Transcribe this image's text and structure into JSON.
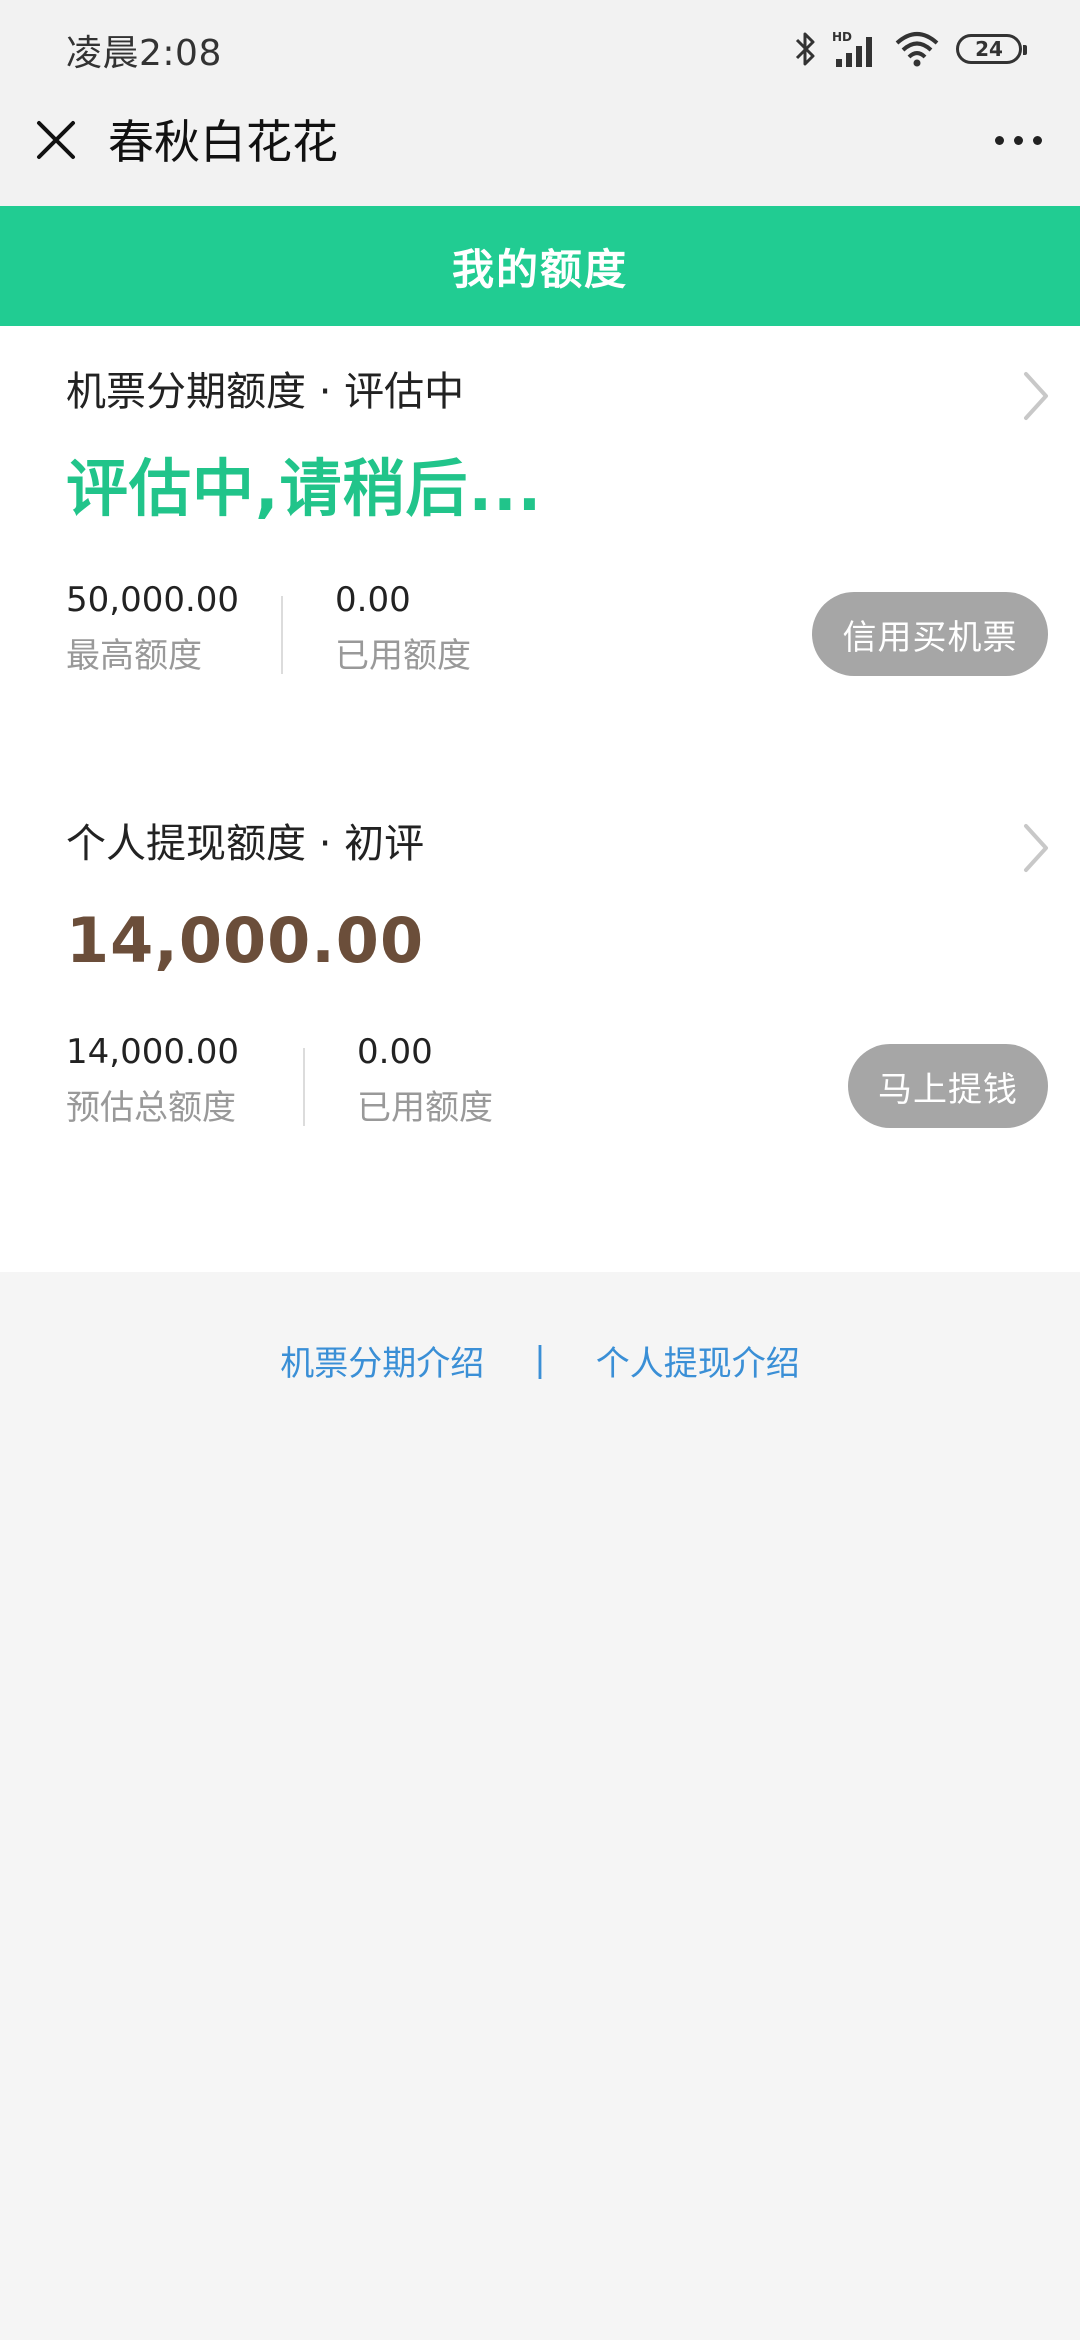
{
  "status_bar": {
    "time": "凌晨2:08",
    "battery": "24",
    "icons": [
      "bluetooth-icon",
      "hd-signal-icon",
      "wifi-icon",
      "battery-icon"
    ]
  },
  "nav": {
    "title": "春秋白花花"
  },
  "header": {
    "title": "我的额度",
    "color": "#21cc92"
  },
  "cards": [
    {
      "heading": "机票分期额度 · 评估中",
      "big_value": "评估中,请稍后...",
      "big_value_color": "#21c48a",
      "stats": [
        {
          "value": "50,000.00",
          "label": "最高额度"
        },
        {
          "value": "0.00",
          "label": "已用额度"
        }
      ],
      "button": "信用买机票"
    },
    {
      "heading": "个人提现额度 · 初评",
      "big_value": "14,000.00",
      "big_value_color": "#6b4e3a",
      "stats": [
        {
          "value": "14,000.00",
          "label": "预估总额度"
        },
        {
          "value": "0.00",
          "label": "已用额度"
        }
      ],
      "button": "马上提钱"
    }
  ],
  "footer": {
    "link_1": "机票分期介绍",
    "separator": "|",
    "link_2": "个人提现介绍",
    "link_color": "#3a8fd6"
  }
}
